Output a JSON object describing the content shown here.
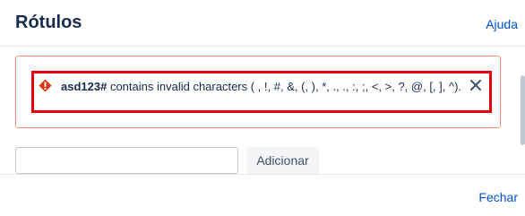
{
  "dialog": {
    "title": "Rótulos",
    "help_label": "Ajuda",
    "close_label": "Fechar"
  },
  "error": {
    "label_name": "asd123#",
    "message": " contains invalid characters ( , !, #, &, (, ), *, ., ., :, ;, <, >, ?, @, [, ], ^).",
    "icon": "warning-icon",
    "dismiss_icon": "close-icon"
  },
  "form": {
    "input_value": "",
    "input_placeholder": "",
    "add_label": "Adicionar"
  },
  "colors": {
    "accent": "#0052cc",
    "error_border": "#e5000f",
    "error_outer_border": "#ff8f73",
    "error_icon": "#de350b"
  }
}
